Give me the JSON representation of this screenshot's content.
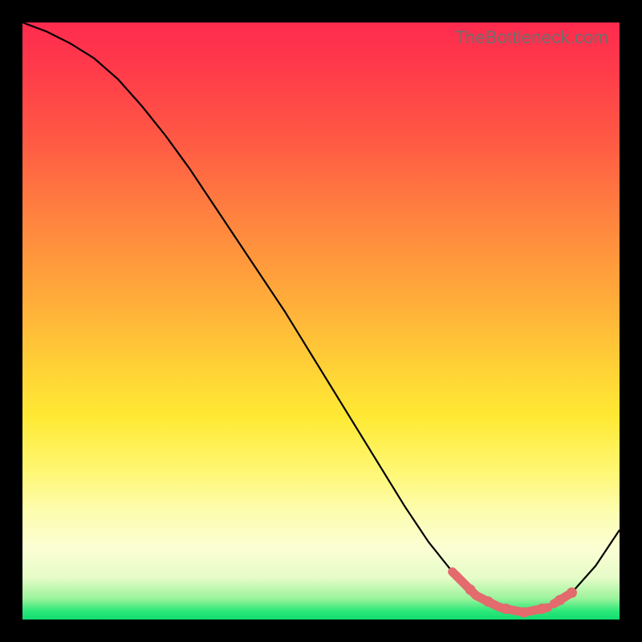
{
  "watermark": "TheBottleneck.com",
  "colors": {
    "background": "#000000",
    "curve": "#000000",
    "accent": "#e36a6d"
  },
  "chart_data": {
    "type": "line",
    "title": "",
    "xlabel": "",
    "ylabel": "",
    "xlim": [
      0,
      100
    ],
    "ylim": [
      0,
      100
    ],
    "x": [
      0,
      4,
      8,
      12,
      16,
      20,
      24,
      28,
      32,
      36,
      40,
      44,
      48,
      52,
      56,
      60,
      64,
      68,
      72,
      76,
      80,
      84,
      88,
      92,
      96,
      100
    ],
    "values": [
      100,
      98.5,
      96.5,
      94,
      90.5,
      86,
      81,
      75.5,
      69.5,
      63.5,
      57.5,
      51.5,
      45,
      38.5,
      32,
      25.5,
      19,
      13,
      8,
      4,
      2,
      1.2,
      2,
      4.5,
      9,
      15
    ],
    "optimal_range_x": [
      72,
      92
    ],
    "accent_segments": [
      {
        "x0": 72,
        "x1": 76
      },
      {
        "x0": 76,
        "x1": 88
      },
      {
        "x0": 89,
        "x1": 92
      }
    ],
    "accent_dots_x": [
      75,
      78,
      81,
      84,
      87,
      90,
      92
    ]
  }
}
